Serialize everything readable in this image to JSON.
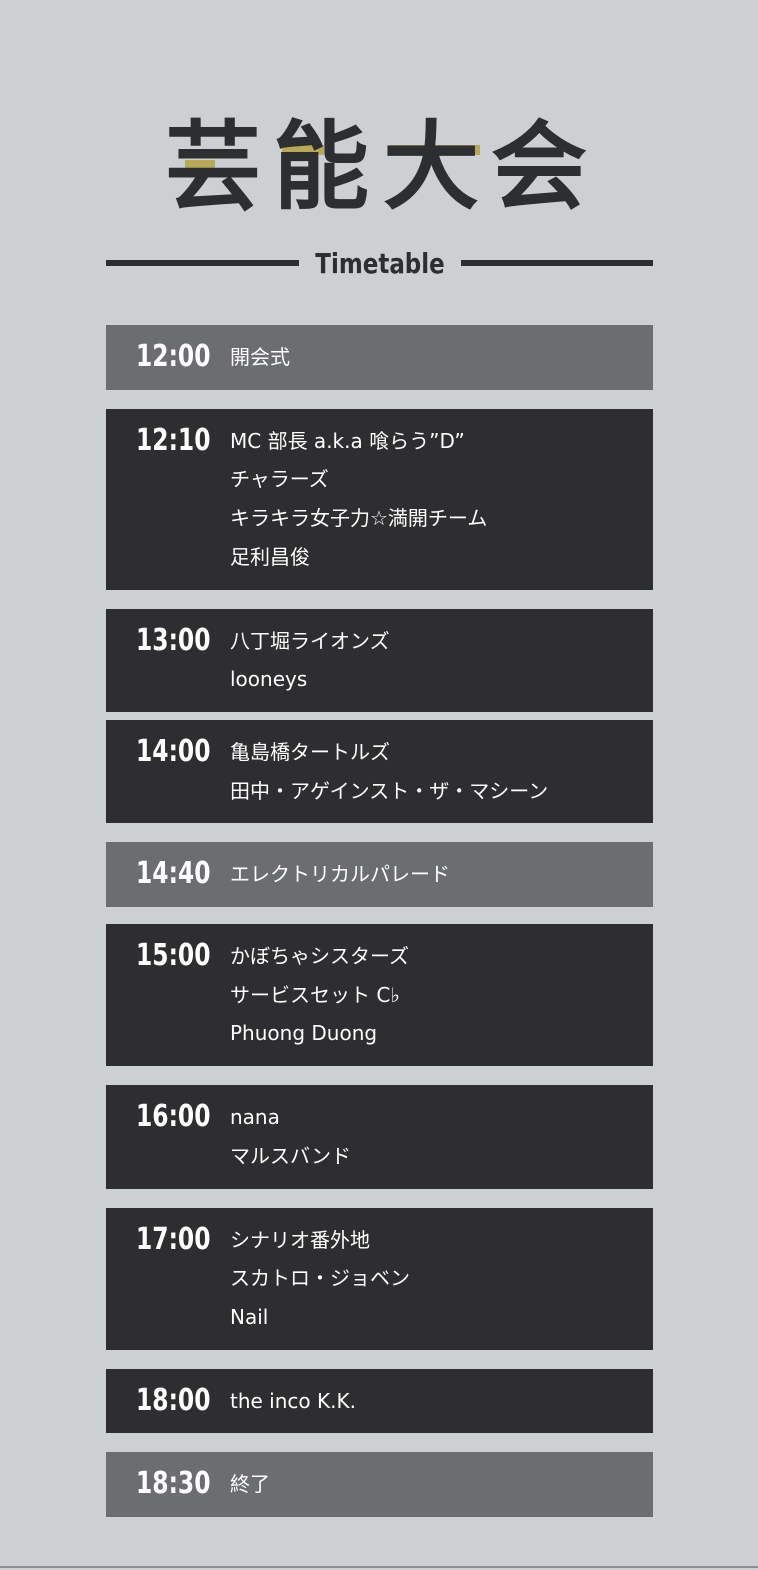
{
  "header": {
    "title_chars": [
      "芸",
      "能",
      "大",
      "会"
    ],
    "subtitle": "Timetable"
  },
  "colors": {
    "background": "#cdd0d3",
    "ink": "#2d2e31",
    "gold": "#b9a957",
    "slot_dark": "#2e2e30",
    "slot_light": "#6c6d71",
    "text_light": "#ffffff"
  },
  "schedule": [
    {
      "time": "12:00",
      "style": "light",
      "acts": [
        "開会式"
      ]
    },
    {
      "time": "12:10",
      "style": "dark",
      "acts": [
        "MC 部長 a.k.a 喰らう”D”",
        "チャラーズ",
        "キラキラ女子力☆満開チーム",
        "足利昌俊"
      ]
    },
    {
      "time": "13:00",
      "style": "dark",
      "acts": [
        "八丁堀ライオンズ",
        "looneys"
      ]
    },
    {
      "time": "14:00",
      "style": "dark",
      "acts": [
        "亀島橋タートルズ",
        "田中・アゲインスト・ザ・マシーン"
      ]
    },
    {
      "time": "14:40",
      "style": "light",
      "acts": [
        "エレクトリカルパレード"
      ]
    },
    {
      "time": "15:00",
      "style": "dark",
      "acts": [
        "かぼちゃシスターズ",
        "サービスセット C♭",
        "Phuong Duong"
      ]
    },
    {
      "time": "16:00",
      "style": "dark",
      "acts": [
        "nana",
        "マルスバンド"
      ]
    },
    {
      "time": "17:00",
      "style": "dark",
      "acts": [
        "シナリオ番外地",
        "スカトロ・ジョベン",
        "Nail"
      ]
    },
    {
      "time": "18:00",
      "style": "dark",
      "acts": [
        "the inco K.K."
      ]
    },
    {
      "time": "18:30",
      "style": "light",
      "acts": [
        "終了"
      ]
    }
  ]
}
